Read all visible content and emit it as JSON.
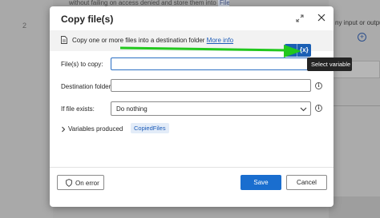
{
  "background": {
    "line_number": "2",
    "top_text": "without failing on access denied and store them into",
    "top_token": "Files",
    "right_text": "ny input or output"
  },
  "dialog": {
    "title": "Copy file(s)",
    "info": {
      "text": "Copy one or more files into a destination folder",
      "link": "More info"
    },
    "fields": {
      "files_label": "File(s) to copy:",
      "files_value": "",
      "destination_label": "Destination folder:",
      "destination_value": "",
      "if_exists_label": "If file exists:",
      "if_exists_value": "Do nothing"
    },
    "variables": {
      "label": "Variables produced",
      "chip": "CopiedFiles"
    },
    "buttons": {
      "on_error": "On error",
      "save": "Save",
      "cancel": "Cancel"
    }
  },
  "variable_button": {
    "label": "{x}",
    "tooltip": "Select variable"
  },
  "colors": {
    "accent": "#1a6ecf",
    "annotation_arrow": "#22c81e",
    "link": "#1c5bb8"
  }
}
